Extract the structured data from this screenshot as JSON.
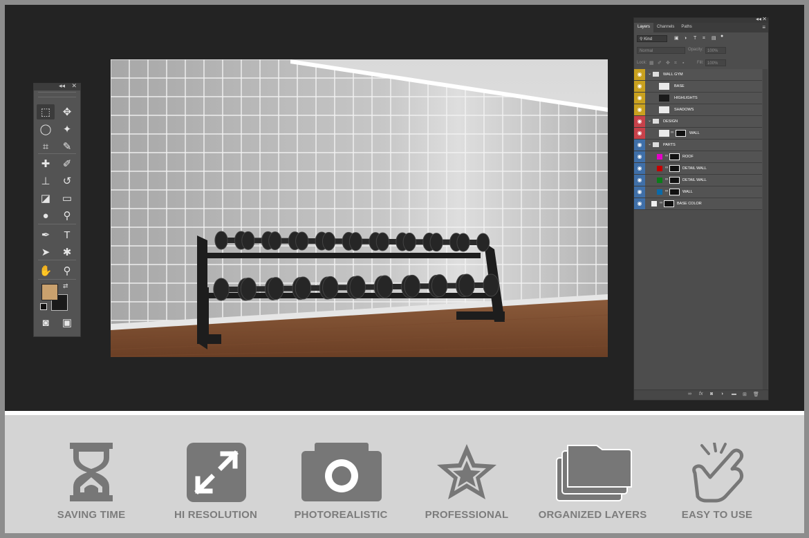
{
  "tools_panel": {
    "collapse_glyph": "◂◂",
    "close_glyph": "✕",
    "tools": [
      {
        "name": "marquee-tool-icon",
        "glyph": "⬚"
      },
      {
        "name": "move-tool-icon",
        "glyph": "✥"
      },
      {
        "name": "lasso-tool-icon",
        "glyph": "◯"
      },
      {
        "name": "magic-wand-tool-icon",
        "glyph": "✦"
      },
      {
        "name": "crop-tool-icon",
        "glyph": "⌗"
      },
      {
        "name": "eyedropper-tool-icon",
        "glyph": "✎"
      },
      {
        "name": "healing-brush-tool-icon",
        "glyph": "✚"
      },
      {
        "name": "brush-tool-icon",
        "glyph": "✐"
      },
      {
        "name": "clone-stamp-tool-icon",
        "glyph": "⊥"
      },
      {
        "name": "history-brush-tool-icon",
        "glyph": "↺"
      },
      {
        "name": "eraser-tool-icon",
        "glyph": "◪"
      },
      {
        "name": "gradient-tool-icon",
        "glyph": "▭"
      },
      {
        "name": "blur-tool-icon",
        "glyph": "●"
      },
      {
        "name": "dodge-tool-icon",
        "glyph": "⚲"
      },
      {
        "name": "pen-tool-icon",
        "glyph": "✒"
      },
      {
        "name": "type-tool-icon",
        "glyph": "T"
      },
      {
        "name": "path-selection-tool-icon",
        "glyph": "➤"
      },
      {
        "name": "custom-shape-tool-icon",
        "glyph": "✱"
      },
      {
        "name": "hand-tool-icon",
        "glyph": "✋"
      },
      {
        "name": "zoom-tool-icon",
        "glyph": "⚲"
      },
      {
        "name": "quick-mask-icon",
        "glyph": "◙"
      },
      {
        "name": "screen-mode-icon",
        "glyph": "▣"
      }
    ],
    "foreground_color": "#c9a16e",
    "background_color": "#1a1a1a"
  },
  "layers_panel": {
    "collapse_glyph": "◂◂",
    "close_glyph": "✕",
    "tabs": [
      "Layers",
      "Channels",
      "Paths"
    ],
    "active_tab": "Layers",
    "menu_glyph": "≡",
    "filter_kind": "Kind",
    "blend_mode": "Normal",
    "opacity_label": "Opacity:",
    "opacity_value": "100%",
    "lock_label": "Lock:",
    "fill_label": "Fill:",
    "fill_value": "100%",
    "layers": [
      {
        "name": "WALL GYM",
        "type": "group",
        "indent": 0,
        "tag": "#c9a11f"
      },
      {
        "name": "BASE",
        "type": "layer",
        "indent": 1,
        "tag": "#c9a11f"
      },
      {
        "name": "HIGHLIGHTS",
        "type": "layer",
        "indent": 1,
        "tag": "#c9a11f"
      },
      {
        "name": "SHADOWS",
        "type": "layer",
        "indent": 1,
        "tag": "#c9a11f"
      },
      {
        "name": "DESIGN",
        "type": "group",
        "indent": 0,
        "tag": "#c8414a"
      },
      {
        "name": "WALL",
        "type": "smart",
        "indent": 1,
        "tag": "#c8414a"
      },
      {
        "name": "PARTS",
        "type": "group",
        "indent": 0,
        "tag": "#3f6fa8"
      },
      {
        "name": "ROOF",
        "type": "fill",
        "indent": 1,
        "tag": "#3f6fa8",
        "swatch": "#e400c8"
      },
      {
        "name": "DETAIL WALL",
        "type": "fill",
        "indent": 1,
        "tag": "#3f6fa8",
        "swatch": "#c40000"
      },
      {
        "name": "DETAIL WALL",
        "type": "fill",
        "indent": 1,
        "tag": "#3f6fa8",
        "swatch": "#0b7c1a"
      },
      {
        "name": "WALL",
        "type": "fill",
        "indent": 1,
        "tag": "#3f6fa8",
        "swatch": "#0b6aa8"
      },
      {
        "name": "BASE COLOR",
        "type": "fill",
        "indent": 0,
        "tag": "#3f6fa8",
        "swatch": "#f0f0f0"
      }
    ]
  },
  "features": [
    {
      "label": "SAVING TIME",
      "icon": "hourglass-icon"
    },
    {
      "label": "HI RESOLUTION",
      "icon": "expand-arrows-icon"
    },
    {
      "label": "PHOTOREALISTIC",
      "icon": "camera-icon"
    },
    {
      "label": "PROFESSIONAL",
      "icon": "star-icon"
    },
    {
      "label": "ORGANIZED LAYERS",
      "icon": "folders-icon"
    },
    {
      "label": "EASY TO USE",
      "icon": "hand-tap-icon"
    }
  ],
  "colors": {
    "workspace_bg": "#232323",
    "panel_bg": "#535353",
    "feature_text": "#7c7c7c",
    "feature_icon": "#777777"
  }
}
